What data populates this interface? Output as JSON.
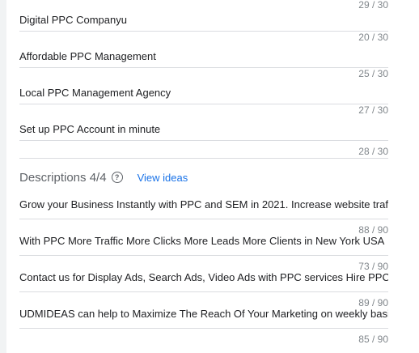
{
  "headlines": [
    {
      "counter": "29 / 30",
      "value": "Digital PPC Companyu"
    },
    {
      "counter": "20 / 30",
      "value": "Affordable PPC Management"
    },
    {
      "counter": "25 / 30",
      "value": "Local PPC Management Agency"
    },
    {
      "counter": "27 / 30",
      "value": "Set up PPC Account in minute"
    },
    {
      "counter": "28 / 30",
      "value": ""
    }
  ],
  "descriptions_section": {
    "title": "Descriptions 4/4",
    "help_icon": "help-circle-icon",
    "view_ideas_label": "View ideas"
  },
  "descriptions": [
    {
      "value": "Grow your Business Instantly with PPC and SEM in 2021. Increase website traffic",
      "counter": ""
    },
    {
      "value": "With PPC More Traffic More Clicks More Leads More Clients in New York USA",
      "counter": "88 / 90"
    },
    {
      "value": "Contact us for Display Ads, Search Ads, Video Ads with PPC services Hire PPC",
      "counter": "73 / 90"
    },
    {
      "value": "UDMIDEAS can help to Maximize The Reach Of Your Marketing on weekly basis",
      "counter": "89 / 90"
    },
    {
      "value": "",
      "counter": "85 / 90"
    }
  ]
}
